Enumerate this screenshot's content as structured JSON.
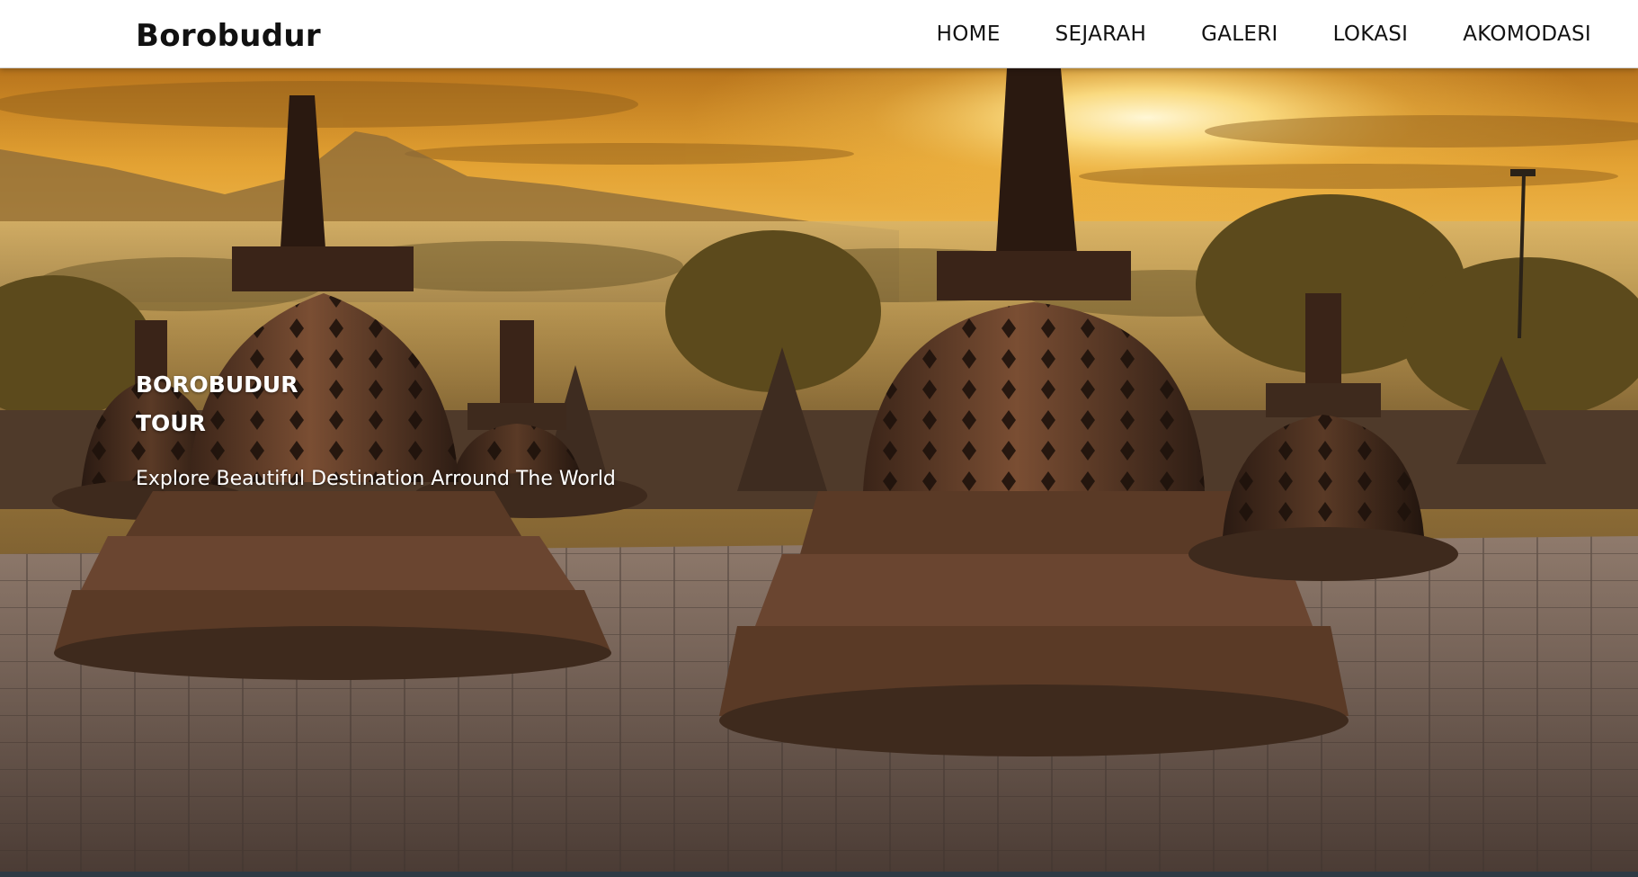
{
  "brand": "Borobudur",
  "nav": {
    "items": [
      {
        "label": "HOME"
      },
      {
        "label": "SEJARAH"
      },
      {
        "label": "GALERI"
      },
      {
        "label": "LOKASI"
      },
      {
        "label": "AKOMODASI"
      }
    ]
  },
  "hero": {
    "title": "BOROBUDUR TOUR",
    "subtitle": "Explore Beautiful Destination Arround The World",
    "image_icon": "borobudur-sunrise-photo"
  },
  "colors": {
    "navbar_bg": "#ffffff",
    "text_dark": "#111111",
    "hero_text": "#ffffff",
    "sky_glow": "#f7c64a",
    "stone": "#5a3a26"
  }
}
